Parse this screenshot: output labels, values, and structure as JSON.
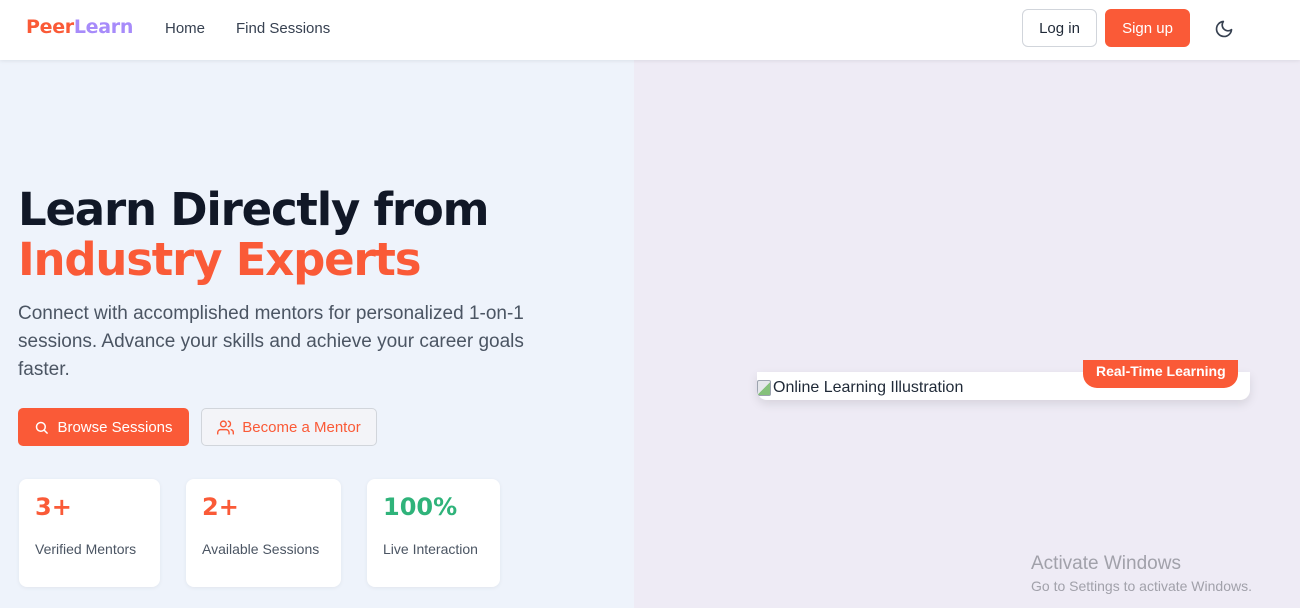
{
  "header": {
    "logo_part1": "Peer",
    "logo_part2": "Learn",
    "nav": [
      "Home",
      "Find Sessions"
    ],
    "login_label": "Log in",
    "signup_label": "Sign up",
    "theme_icon": "moon-icon"
  },
  "hero": {
    "title_line1": "Learn Directly from",
    "title_line2": "Industry Experts",
    "subtitle": "Connect with accomplished mentors for personalized 1-on-1 sessions. Advance your skills and achieve your career goals faster.",
    "browse_label": "Browse Sessions",
    "mentor_label": "Become a Mentor",
    "stats": [
      {
        "value": "3+",
        "label": "Verified Mentors",
        "color": "#fa5a37"
      },
      {
        "value": "2+",
        "label": "Available Sessions",
        "color": "#fa5a37"
      },
      {
        "value": "100%",
        "label": "Live Interaction",
        "color": "#2fb37a"
      }
    ]
  },
  "illustration": {
    "alt_text": "Online Learning Illustration",
    "badge_label": "Real-Time Learning"
  },
  "watermark": {
    "title": "Activate Windows",
    "subtitle": "Go to Settings to activate Windows."
  },
  "colors": {
    "accent": "#fa5a37",
    "logo_secondary": "#a78bfa",
    "success": "#2fb37a"
  }
}
